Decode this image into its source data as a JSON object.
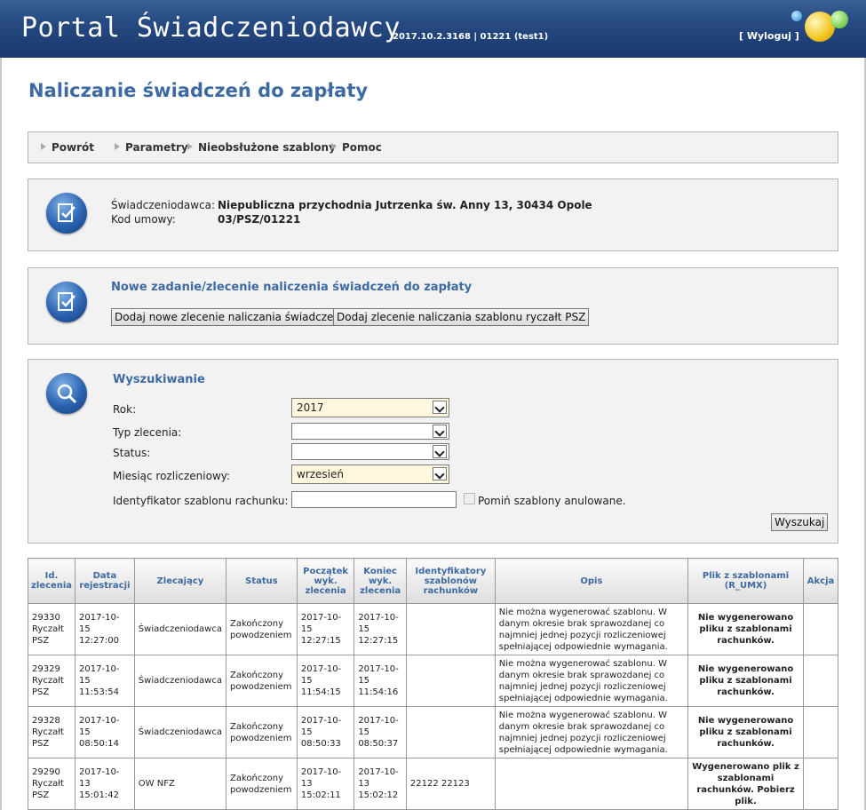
{
  "header": {
    "title": "Portal Świadczeniodawcy",
    "version": "2017.10.2.3168 | 01221 (test1)",
    "logout": "[ Wyloguj ]"
  },
  "page_title": "Naliczanie świadczeń do zapłaty",
  "nav": [
    "Powrót",
    "Parametry",
    "Nieobsłużone szablony",
    "Pomoc"
  ],
  "provider": {
    "provider_label": "Świadczeniodawca:",
    "provider_value": "Niepubliczna przychodnia Jutrzenka św. Anny 13, 30434 Opole",
    "contract_label": "Kod umowy:",
    "contract_value": "03/PSZ/01221"
  },
  "new_task": {
    "heading": "Nowe zadanie/zlecenie naliczenia świadczeń do zapłaty",
    "btn_new": "Dodaj nowe zlecenie naliczania świadczeń",
    "btn_template": "Dodaj zlecenie naliczania szablonu ryczałt PSZ"
  },
  "search": {
    "heading": "Wyszukiwanie",
    "year_label": "Rok:",
    "year_value": "2017",
    "type_label": "Typ zlecenia:",
    "type_value": "",
    "status_label": "Status:",
    "status_value": "",
    "month_label": "Miesiąc rozliczeniowy:",
    "month_value": "wrzesień",
    "template_id_label": "Identyfikator szablonu rachunku:",
    "template_id_value": "",
    "skip_cancelled_label": "Pomiń szablony anulowane.",
    "search_button": "Wyszukaj"
  },
  "table": {
    "headers": [
      "Id. zlecenia",
      "Data rejestracji",
      "Zlecający",
      "Status",
      "Początek wyk. zlecenia",
      "Koniec wyk. zlecenia",
      "Identyfikatory szablonów rachunków",
      "Opis",
      "Plik z szablonami (R_UMX)",
      "Akcja"
    ],
    "rows": [
      {
        "id": "29330 Ryczałt PSZ",
        "registered": "2017-10-15 12:27:00",
        "requester": "Świadczeniodawca",
        "status": "Zakończony powodzeniem",
        "start": "2017-10-15 12:27:15",
        "end": "2017-10-15 12:27:15",
        "template_ids": "",
        "description": "Nie można wygenerować szablonu. W danym okresie brak sprawozdanej co najmniej jednej pozycji rozliczeniowej spełniającej odpowiednie wymagania.",
        "file": "Nie wygenerowano pliku z szablonami rachunków.",
        "file_ok": false,
        "action": ""
      },
      {
        "id": "29329 Ryczałt PSZ",
        "registered": "2017-10-15 11:53:54",
        "requester": "Świadczeniodawca",
        "status": "Zakończony powodzeniem",
        "start": "2017-10-15 11:54:15",
        "end": "2017-10-15 11:54:16",
        "template_ids": "",
        "description": "Nie można wygenerować szablonu. W danym okresie brak sprawozdanej co najmniej jednej pozycji rozliczeniowej spełniającej odpowiednie wymagania.",
        "file": "Nie wygenerowano pliku z szablonami rachunków.",
        "file_ok": false,
        "action": ""
      },
      {
        "id": "29328 Ryczałt PSZ",
        "registered": "2017-10-15 08:50:14",
        "requester": "Świadczeniodawca",
        "status": "Zakończony powodzeniem",
        "start": "2017-10-15 08:50:33",
        "end": "2017-10-15 08:50:37",
        "template_ids": "",
        "description": "Nie można wygenerować szablonu. W danym okresie brak sprawozdanej co najmniej jednej pozycji rozliczeniowej spełniającej odpowiednie wymagania.",
        "file": "Nie wygenerowano pliku z szablonami rachunków.",
        "file_ok": false,
        "action": ""
      },
      {
        "id": "29290 Ryczałt PSZ",
        "registered": "2017-10-13 15:01:42",
        "requester": "OW NFZ",
        "status": "Zakończony powodzeniem",
        "start": "2017-10-13 15:02:11",
        "end": "2017-10-13 15:02:12",
        "template_ids": "22122 22123",
        "description": "",
        "file": "Wygenerowano plik z szablonami rachunków. Pobierz plik.",
        "file_ok": true,
        "action": ""
      }
    ]
  },
  "colors": {
    "accent": "#3d6aa2",
    "header_bg": "#264a82",
    "success": "#2a8a1a"
  }
}
